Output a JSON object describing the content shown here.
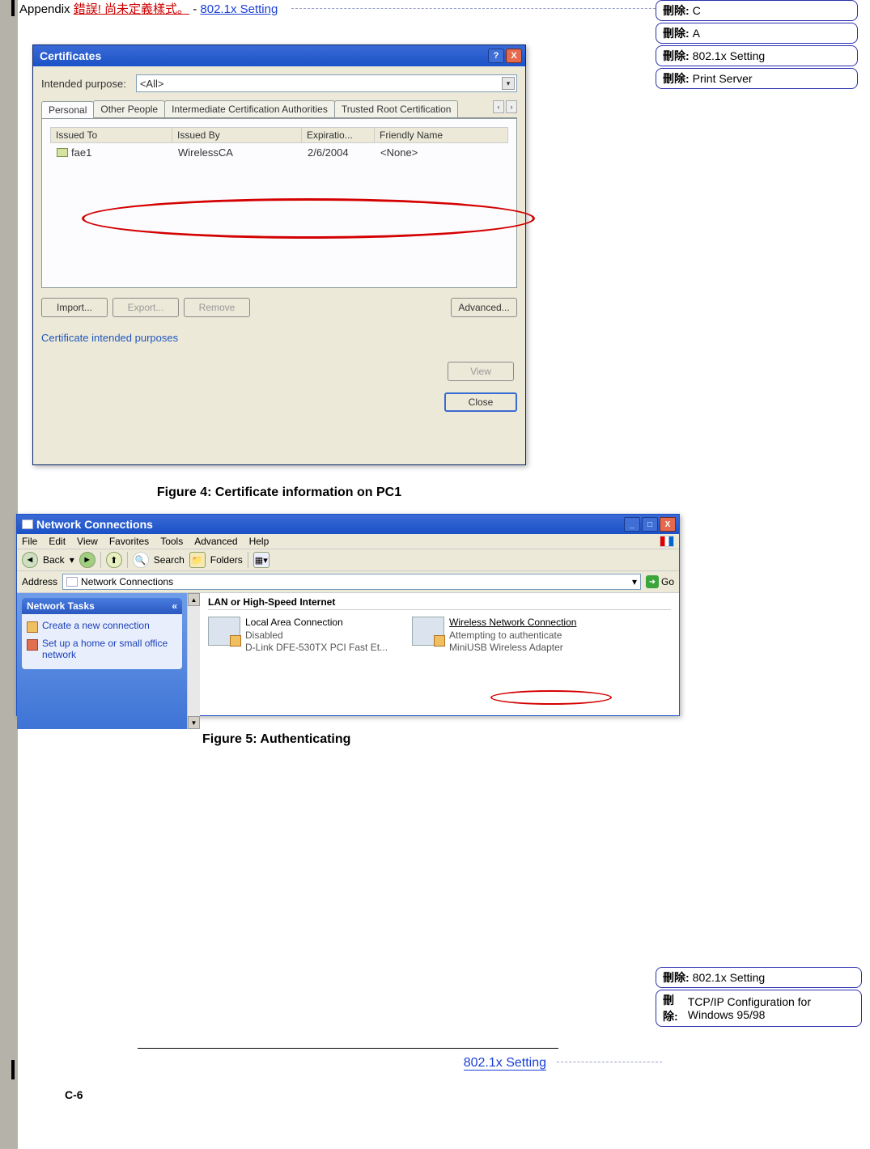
{
  "header": {
    "appendix": "Appendix ",
    "error_text": "錯誤! 尚未定義樣式。",
    "dash": " - ",
    "link": "802.1x Setting"
  },
  "revisions_top": [
    {
      "label": "刪除:",
      "text": "C"
    },
    {
      "label": "刪除:",
      "text": "A"
    },
    {
      "label": "刪除:",
      "text": "802.1x Setting"
    },
    {
      "label": "刪除:",
      "text": "Print Server"
    }
  ],
  "cert": {
    "title": "Certificates",
    "help": "?",
    "close_x": "X",
    "purpose_label": "Intended purpose:",
    "purpose_value": "<All>",
    "tabs": [
      "Personal",
      "Other People",
      "Intermediate Certification Authorities",
      "Trusted Root Certification"
    ],
    "scroll_left": "‹",
    "scroll_right": "›",
    "cols": {
      "c1": "Issued To",
      "c2": "Issued By",
      "c3": "Expiratio...",
      "c4": "Friendly Name"
    },
    "row": {
      "c1": "fae1",
      "c2": "WirelessCA",
      "c3": "2/6/2004",
      "c4": "<None>"
    },
    "import": "Import...",
    "export": "Export...",
    "remove": "Remove",
    "advanced": "Advanced...",
    "purposes_label": "Certificate intended purposes",
    "view": "View",
    "close": "Close"
  },
  "caption1": "Figure 4: Certificate information on PC1",
  "net": {
    "title": "Network Connections",
    "min": "_",
    "max": "□",
    "close": "X",
    "menu": [
      "File",
      "Edit",
      "View",
      "Favorites",
      "Tools",
      "Advanced",
      "Help"
    ],
    "back": "Back",
    "fwd": "",
    "up": "",
    "search": "Search",
    "folders": "Folders",
    "view": "",
    "addr_label": "Address",
    "addr_value": "Network Connections",
    "go": "Go",
    "side_title": "Network Tasks",
    "side_chev": "«",
    "side_items": [
      "Create a new connection",
      "Set up a home or small office network"
    ],
    "category": "LAN or High-Speed Internet",
    "conn1": {
      "t1": "Local Area Connection",
      "t2": "Disabled",
      "t3": "D-Link DFE-530TX PCI Fast Et..."
    },
    "conn2": {
      "t1": "Wireless Network Connection",
      "t2": "Attempting to authenticate",
      "t3": "MiniUSB Wireless Adapter"
    },
    "sb_up": "▲",
    "sb_dn": "▼"
  },
  "caption2": "Figure 5: Authenticating",
  "revisions_bottom": [
    {
      "label": "刪除:",
      "text": "802.1x Setting"
    },
    {
      "label": "刪除:",
      "text": "TCP/IP Configuration for Windows 95/98"
    }
  ],
  "footer": {
    "link": "802.1x Setting",
    "page": "C-6"
  }
}
